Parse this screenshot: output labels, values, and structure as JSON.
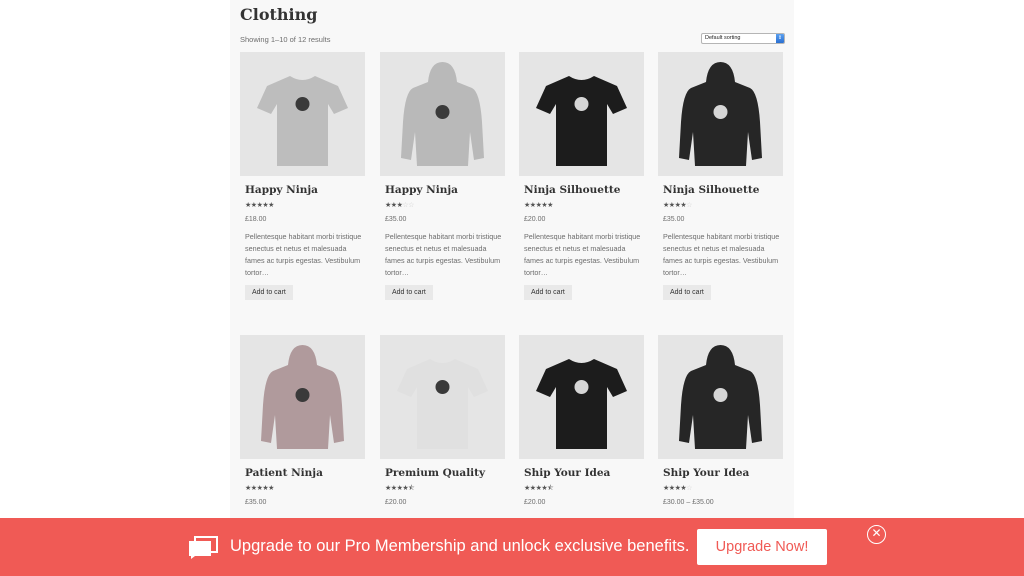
{
  "page": {
    "title": "Clothing",
    "result_count": "Showing 1–10 of 12 results",
    "sort": {
      "selected": "Default sorting"
    }
  },
  "products": [
    {
      "name": "Happy Ninja",
      "rating": 5,
      "price": "£18.00",
      "description": "Pellentesque habitant morbi tristique senectus et netus et malesuada fames ac turpis egestas. Vestibulum tortor…",
      "cart_label": "Add to cart",
      "image": "t-shirt",
      "color": "#bdbdbd"
    },
    {
      "name": "Happy Ninja",
      "rating": 3,
      "price": "£35.00",
      "description": "Pellentesque habitant morbi tristique senectus et netus et malesuada fames ac turpis egestas. Vestibulum tortor…",
      "cart_label": "Add to cart",
      "image": "hoodie",
      "color": "#b9b9b9"
    },
    {
      "name": "Ninja Silhouette",
      "rating": 5,
      "price": "£20.00",
      "description": "Pellentesque habitant morbi tristique senectus et netus et malesuada fames ac turpis egestas. Vestibulum tortor…",
      "cart_label": "Add to cart",
      "image": "t-shirt",
      "color": "#1c1c1c"
    },
    {
      "name": "Ninja Silhouette",
      "rating": 4,
      "price": "£35.00",
      "description": "Pellentesque habitant morbi tristique senectus et netus et malesuada fames ac turpis egestas. Vestibulum tortor…",
      "cart_label": "Add to cart",
      "image": "hoodie",
      "color": "#262626"
    },
    {
      "name": "Patient Ninja",
      "rating": 5,
      "price": "£35.00",
      "image": "hoodie",
      "color": "#b09a9c"
    },
    {
      "name": "Premium Quality",
      "rating": 4.5,
      "price": "£20.00",
      "image": "t-shirt",
      "color": "#e0e0e0"
    },
    {
      "name": "Ship Your Idea",
      "rating": 4.5,
      "price": "£20.00",
      "image": "t-shirt",
      "color": "#1c1c1c"
    },
    {
      "name": "Ship Your Idea",
      "rating": 4,
      "price": "£30.00 – £35.00",
      "image": "hoodie",
      "color": "#262626"
    }
  ],
  "banner": {
    "text": "Upgrade to our Pro Membership and unlock exclusive benefits.",
    "button_label": "Upgrade Now!",
    "icon": "chat-bubbles-icon",
    "close_icon": "close-circle-icon",
    "close_glyph": "✕",
    "background": "#f05a55"
  }
}
